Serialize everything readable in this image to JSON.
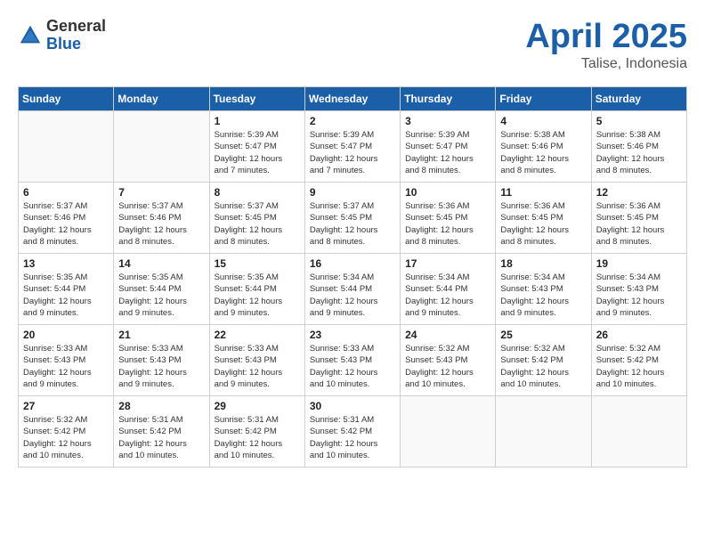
{
  "header": {
    "logo_general": "General",
    "logo_blue": "Blue",
    "title": "April 2025",
    "location": "Talise, Indonesia"
  },
  "weekdays": [
    "Sunday",
    "Monday",
    "Tuesday",
    "Wednesday",
    "Thursday",
    "Friday",
    "Saturday"
  ],
  "weeks": [
    [
      {
        "day": "",
        "detail": ""
      },
      {
        "day": "",
        "detail": ""
      },
      {
        "day": "1",
        "detail": "Sunrise: 5:39 AM\nSunset: 5:47 PM\nDaylight: 12 hours\nand 7 minutes."
      },
      {
        "day": "2",
        "detail": "Sunrise: 5:39 AM\nSunset: 5:47 PM\nDaylight: 12 hours\nand 7 minutes."
      },
      {
        "day": "3",
        "detail": "Sunrise: 5:39 AM\nSunset: 5:47 PM\nDaylight: 12 hours\nand 8 minutes."
      },
      {
        "day": "4",
        "detail": "Sunrise: 5:38 AM\nSunset: 5:46 PM\nDaylight: 12 hours\nand 8 minutes."
      },
      {
        "day": "5",
        "detail": "Sunrise: 5:38 AM\nSunset: 5:46 PM\nDaylight: 12 hours\nand 8 minutes."
      }
    ],
    [
      {
        "day": "6",
        "detail": "Sunrise: 5:37 AM\nSunset: 5:46 PM\nDaylight: 12 hours\nand 8 minutes."
      },
      {
        "day": "7",
        "detail": "Sunrise: 5:37 AM\nSunset: 5:46 PM\nDaylight: 12 hours\nand 8 minutes."
      },
      {
        "day": "8",
        "detail": "Sunrise: 5:37 AM\nSunset: 5:45 PM\nDaylight: 12 hours\nand 8 minutes."
      },
      {
        "day": "9",
        "detail": "Sunrise: 5:37 AM\nSunset: 5:45 PM\nDaylight: 12 hours\nand 8 minutes."
      },
      {
        "day": "10",
        "detail": "Sunrise: 5:36 AM\nSunset: 5:45 PM\nDaylight: 12 hours\nand 8 minutes."
      },
      {
        "day": "11",
        "detail": "Sunrise: 5:36 AM\nSunset: 5:45 PM\nDaylight: 12 hours\nand 8 minutes."
      },
      {
        "day": "12",
        "detail": "Sunrise: 5:36 AM\nSunset: 5:45 PM\nDaylight: 12 hours\nand 8 minutes."
      }
    ],
    [
      {
        "day": "13",
        "detail": "Sunrise: 5:35 AM\nSunset: 5:44 PM\nDaylight: 12 hours\nand 9 minutes."
      },
      {
        "day": "14",
        "detail": "Sunrise: 5:35 AM\nSunset: 5:44 PM\nDaylight: 12 hours\nand 9 minutes."
      },
      {
        "day": "15",
        "detail": "Sunrise: 5:35 AM\nSunset: 5:44 PM\nDaylight: 12 hours\nand 9 minutes."
      },
      {
        "day": "16",
        "detail": "Sunrise: 5:34 AM\nSunset: 5:44 PM\nDaylight: 12 hours\nand 9 minutes."
      },
      {
        "day": "17",
        "detail": "Sunrise: 5:34 AM\nSunset: 5:44 PM\nDaylight: 12 hours\nand 9 minutes."
      },
      {
        "day": "18",
        "detail": "Sunrise: 5:34 AM\nSunset: 5:43 PM\nDaylight: 12 hours\nand 9 minutes."
      },
      {
        "day": "19",
        "detail": "Sunrise: 5:34 AM\nSunset: 5:43 PM\nDaylight: 12 hours\nand 9 minutes."
      }
    ],
    [
      {
        "day": "20",
        "detail": "Sunrise: 5:33 AM\nSunset: 5:43 PM\nDaylight: 12 hours\nand 9 minutes."
      },
      {
        "day": "21",
        "detail": "Sunrise: 5:33 AM\nSunset: 5:43 PM\nDaylight: 12 hours\nand 9 minutes."
      },
      {
        "day": "22",
        "detail": "Sunrise: 5:33 AM\nSunset: 5:43 PM\nDaylight: 12 hours\nand 9 minutes."
      },
      {
        "day": "23",
        "detail": "Sunrise: 5:33 AM\nSunset: 5:43 PM\nDaylight: 12 hours\nand 10 minutes."
      },
      {
        "day": "24",
        "detail": "Sunrise: 5:32 AM\nSunset: 5:43 PM\nDaylight: 12 hours\nand 10 minutes."
      },
      {
        "day": "25",
        "detail": "Sunrise: 5:32 AM\nSunset: 5:42 PM\nDaylight: 12 hours\nand 10 minutes."
      },
      {
        "day": "26",
        "detail": "Sunrise: 5:32 AM\nSunset: 5:42 PM\nDaylight: 12 hours\nand 10 minutes."
      }
    ],
    [
      {
        "day": "27",
        "detail": "Sunrise: 5:32 AM\nSunset: 5:42 PM\nDaylight: 12 hours\nand 10 minutes."
      },
      {
        "day": "28",
        "detail": "Sunrise: 5:31 AM\nSunset: 5:42 PM\nDaylight: 12 hours\nand 10 minutes."
      },
      {
        "day": "29",
        "detail": "Sunrise: 5:31 AM\nSunset: 5:42 PM\nDaylight: 12 hours\nand 10 minutes."
      },
      {
        "day": "30",
        "detail": "Sunrise: 5:31 AM\nSunset: 5:42 PM\nDaylight: 12 hours\nand 10 minutes."
      },
      {
        "day": "",
        "detail": ""
      },
      {
        "day": "",
        "detail": ""
      },
      {
        "day": "",
        "detail": ""
      }
    ]
  ]
}
